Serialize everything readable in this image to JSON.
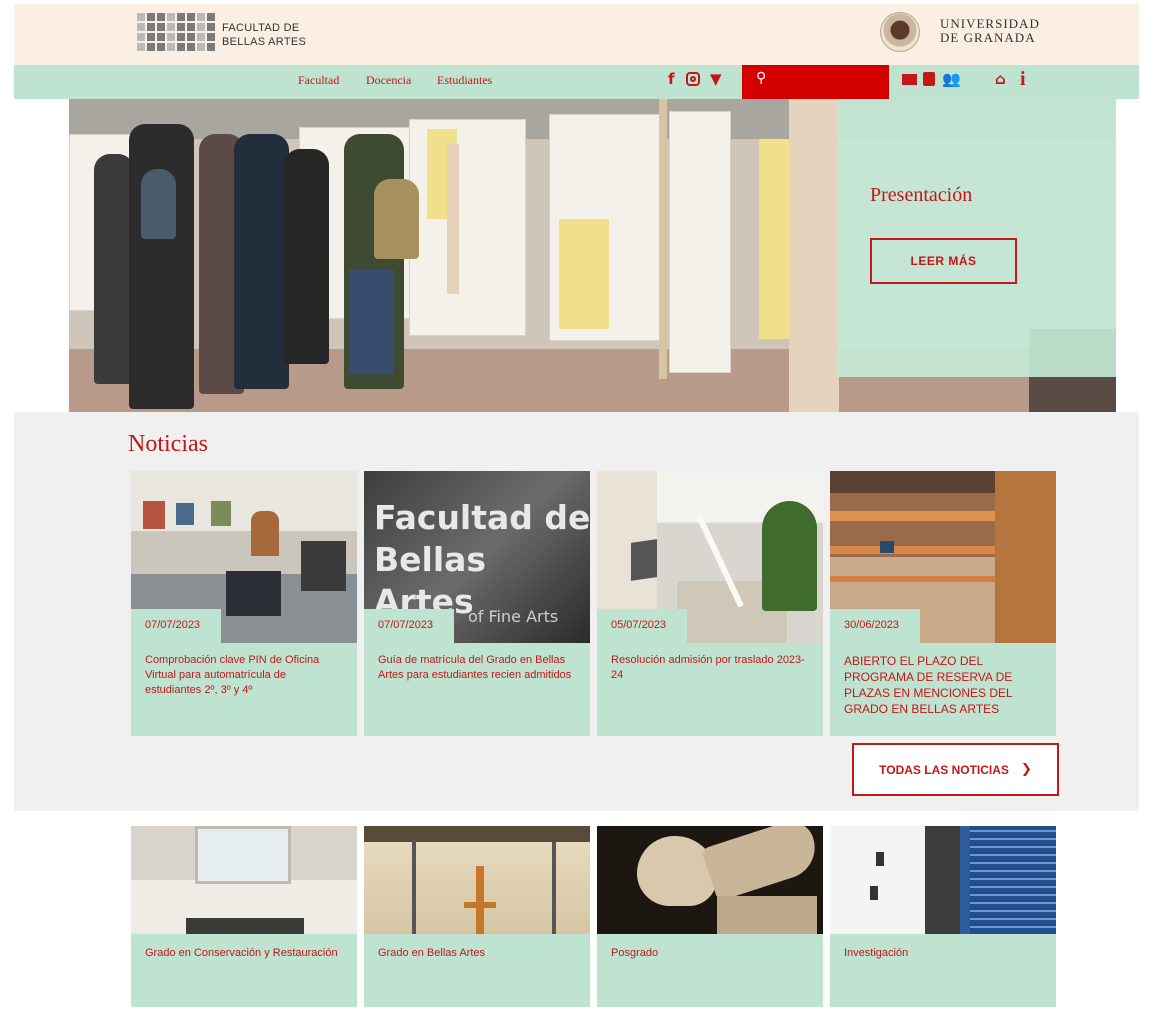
{
  "header": {
    "faculty_name": "FACULTAD DE\nBELLAS ARTES",
    "university_name": "UNIVERSIDAD\nDE GRANADA"
  },
  "nav": {
    "links": [
      "Facultad",
      "Docencia",
      "Estudiantes"
    ],
    "social_icons": [
      "facebook-icon",
      "instagram-icon",
      "twitter-icon"
    ],
    "search_icon": "search-icon",
    "utility_icons": [
      "mail-icon",
      "calendar-icon",
      "users-icon",
      "network-icon",
      "info-icon"
    ]
  },
  "hero": {
    "title": "Presentación",
    "button_label": "LEER MÁS"
  },
  "news": {
    "heading": "Noticias",
    "items": [
      {
        "date": "07/07/2023",
        "title": "Comprobación clave PIN de Oficina Virtual para automatrícula de estudiantes 2º, 3º y 4º"
      },
      {
        "date": "07/07/2023",
        "title": "Guía de matrícula del Grado en Bellas Artes para estudiantes recien admitidos",
        "image_text": "Facultad de\nBellas Artes",
        "image_subtext": "of Fine Arts"
      },
      {
        "date": "05/07/2023",
        "title": "Resolución admisión por traslado 2023-24"
      },
      {
        "date": "30/06/2023",
        "title": "ABIERTO EL PLAZO DEL PROGRAMA DE RESERVA DE PLAZAS EN MENCIONES DEL GRADO EN BELLAS ARTES"
      }
    ],
    "all_button": "TODAS LAS NOTICIAS"
  },
  "programs": [
    {
      "title": "Grado en Conservación y Restauración"
    },
    {
      "title": "Grado en Bellas Artes"
    },
    {
      "title": "Posgrado"
    },
    {
      "title": "Investigación"
    }
  ],
  "colors": {
    "accent": "#c41717",
    "mint": "#bfe3d1",
    "cream": "#fbefe3",
    "search": "#d40000"
  }
}
